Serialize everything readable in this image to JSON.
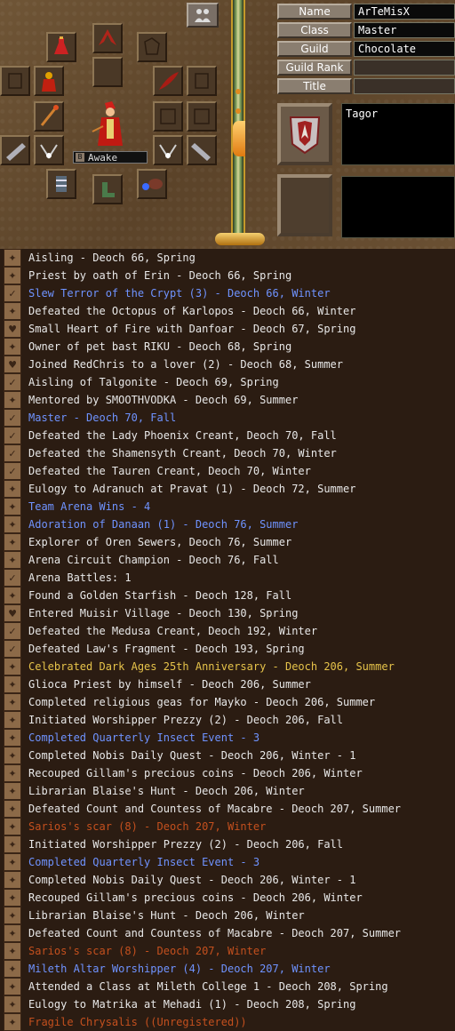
{
  "profile": {
    "labels": [
      "Name",
      "Class",
      "Guild",
      "Guild Rank",
      "Title"
    ],
    "values": [
      "ArTeMisX",
      "Master",
      "Chocolate",
      "",
      ""
    ],
    "status": "Awake",
    "status_level": "B",
    "note": "Tagor"
  },
  "colors": {
    "default": "#e8e8e8",
    "blue": "#6f93ff",
    "gold": "#e6c34a",
    "red": "#c4501e"
  },
  "legend": [
    {
      "icon": "scroll",
      "color": "default",
      "text": "Aisling - Deoch 66, Spring"
    },
    {
      "icon": "scroll",
      "color": "default",
      "text": "Priest by oath of Erin - Deoch 66, Spring"
    },
    {
      "icon": "check",
      "color": "blue",
      "text": "Slew Terror of the Crypt (3) - Deoch 66, Winter"
    },
    {
      "icon": "scroll",
      "color": "default",
      "text": "Defeated the Octopus of Karlopos - Deoch 66, Winter"
    },
    {
      "icon": "heart",
      "color": "default",
      "text": "Small Heart of Fire with Danfoar - Deoch 67, Spring"
    },
    {
      "icon": "scroll",
      "color": "default",
      "text": "Owner of pet bast RIKU - Deoch 68, Spring"
    },
    {
      "icon": "heart",
      "color": "default",
      "text": "Joined RedChris to a lover (2) - Deoch 68, Summer"
    },
    {
      "icon": "check",
      "color": "default",
      "text": "Aisling of Talgonite - Deoch 69, Spring"
    },
    {
      "icon": "scroll",
      "color": "default",
      "text": "Mentored by SMOOTHVODKA - Deoch 69, Summer"
    },
    {
      "icon": "check",
      "color": "blue",
      "text": "Master - Deoch 70, Fall"
    },
    {
      "icon": "check",
      "color": "default",
      "text": "Defeated the Lady Phoenix Creant, Deoch 70, Fall"
    },
    {
      "icon": "check",
      "color": "default",
      "text": "Defeated the Shamensyth Creant, Deoch 70, Winter"
    },
    {
      "icon": "check",
      "color": "default",
      "text": "Defeated the Tauren Creant, Deoch 70, Winter"
    },
    {
      "icon": "scroll",
      "color": "default",
      "text": "Eulogy to Adranuch at Pravat (1) - Deoch 72, Summer"
    },
    {
      "icon": "scroll",
      "color": "blue",
      "text": "Team Arena Wins - 4"
    },
    {
      "icon": "scroll",
      "color": "blue",
      "text": "Adoration of Danaan (1) - Deoch 76, Summer"
    },
    {
      "icon": "scroll",
      "color": "default",
      "text": "Explorer of Oren Sewers, Deoch 76, Summer"
    },
    {
      "icon": "scroll",
      "color": "default",
      "text": "Arena Circuit Champion - Deoch 76, Fall"
    },
    {
      "icon": "check",
      "color": "default",
      "text": "Arena Battles: 1"
    },
    {
      "icon": "scroll",
      "color": "default",
      "text": "Found a Golden Starfish - Deoch 128, Fall"
    },
    {
      "icon": "heart",
      "color": "default",
      "text": "Entered Muisir Village - Deoch 130, Spring"
    },
    {
      "icon": "check",
      "color": "default",
      "text": "Defeated the Medusa Creant, Deoch 192, Winter"
    },
    {
      "icon": "check",
      "color": "default",
      "text": "Defeated Law's Fragment - Deoch 193, Spring"
    },
    {
      "icon": "scroll",
      "color": "gold",
      "text": "Celebrated Dark Ages 25th Anniversary - Deoch 206, Summer"
    },
    {
      "icon": "scroll",
      "color": "default",
      "text": "Glioca Priest by himself - Deoch 206, Summer"
    },
    {
      "icon": "scroll",
      "color": "default",
      "text": "Completed religious geas for Mayko - Deoch 206, Summer"
    },
    {
      "icon": "scroll",
      "color": "default",
      "text": "Initiated Worshipper Prezzy (2) - Deoch 206, Fall"
    },
    {
      "icon": "scroll",
      "color": "blue",
      "text": "Completed Quarterly Insect Event - 3"
    },
    {
      "icon": "scroll",
      "color": "default",
      "text": "Completed Nobis Daily Quest - Deoch 206, Winter - 1"
    },
    {
      "icon": "scroll",
      "color": "default",
      "text": "Recouped Gillam's precious coins - Deoch 206, Winter"
    },
    {
      "icon": "scroll",
      "color": "default",
      "text": "Librarian Blaise's Hunt - Deoch 206, Winter"
    },
    {
      "icon": "scroll",
      "color": "default",
      "text": "Defeated Count and Countess of Macabre - Deoch 207, Summer"
    },
    {
      "icon": "scroll",
      "color": "red",
      "text": "Sarios's scar (8) - Deoch 207, Winter"
    },
    {
      "icon": "scroll",
      "color": "default",
      "text": "Initiated Worshipper Prezzy (2) - Deoch 206, Fall"
    },
    {
      "icon": "scroll",
      "color": "blue",
      "text": "Completed Quarterly Insect Event - 3"
    },
    {
      "icon": "scroll",
      "color": "default",
      "text": "Completed Nobis Daily Quest - Deoch 206, Winter - 1"
    },
    {
      "icon": "scroll",
      "color": "default",
      "text": "Recouped Gillam's precious coins - Deoch 206, Winter"
    },
    {
      "icon": "scroll",
      "color": "default",
      "text": "Librarian Blaise's Hunt - Deoch 206, Winter"
    },
    {
      "icon": "scroll",
      "color": "default",
      "text": "Defeated Count and Countess of Macabre - Deoch 207, Summer"
    },
    {
      "icon": "scroll",
      "color": "red",
      "text": "Sarios's scar (8) - Deoch 207, Winter"
    },
    {
      "icon": "scroll",
      "color": "blue",
      "text": "Mileth Altar Worshipper (4) - Deoch 207, Winter"
    },
    {
      "icon": "scroll",
      "color": "default",
      "text": "Attended a Class at Mileth College 1 - Deoch 208, Spring"
    },
    {
      "icon": "scroll",
      "color": "default",
      "text": "Eulogy to Matrika at Mehadi (1) - Deoch 208, Spring"
    },
    {
      "icon": "scroll",
      "color": "red",
      "text": "Fragile Chrysalis ((Unregistered))"
    }
  ]
}
